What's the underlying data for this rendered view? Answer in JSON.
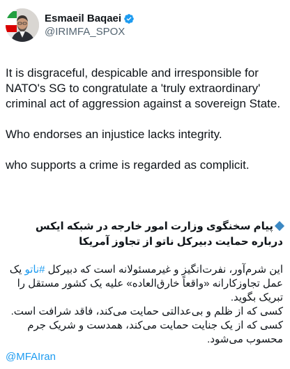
{
  "author": {
    "display_name": "Esmaeil Baqaei",
    "handle": "@IRIMFA_SPOX",
    "verified": true,
    "verified_color": "#1d9bf0"
  },
  "tweet": {
    "paragraphs_en": [
      "It is disgraceful, despicable and irresponsible for NATO's SG to congratulate a 'truly extraordinary' criminal act of aggression against a sovereign State.",
      "Who endorses an injustice lacks integrity.",
      "who supports a crime is regarded as complicit."
    ],
    "fa_headline": "پیام سخنگوی وزارت امور خارجه در شبکه ایکس درباره حمایت دبیرکل ناتو از تجاوز آمریکا",
    "fa_body": {
      "p1_before": "این شرم‌آور، نفرت‌انگیز و غیرمسئولانه است که دبیرکل ",
      "hashtag": "#ناتو",
      "p1_after": " یک عمل تجاوزکارانه «واقعاً خارق‌العاده» علیه یک کشور مستقل را تبریک بگوید.",
      "p2": "کسی که از ظلم و بی‌عدالتی حمایت می‌کند، فاقد شرافت است.",
      "p3": "کسی که از یک جنایت حمایت می‌کند، همدست و شریک جرم محسوب می‌شود."
    },
    "mention": "@MFAIran"
  },
  "colors": {
    "text": "#0f1419",
    "secondary": "#536471",
    "link": "#1d9bf0"
  }
}
